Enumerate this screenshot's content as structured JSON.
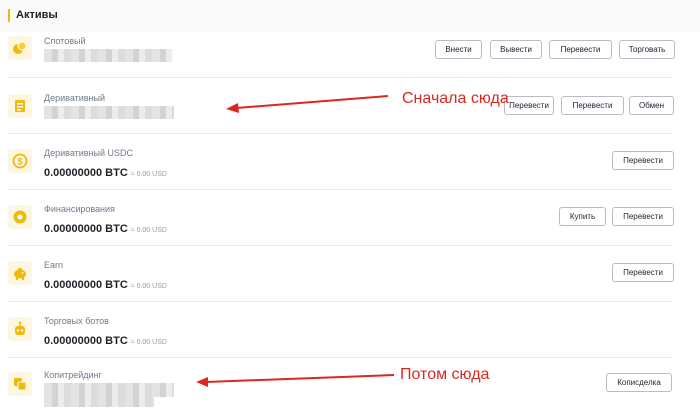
{
  "section": {
    "title": "Активы"
  },
  "accounts": [
    {
      "name": "Спотовый",
      "buttons": [
        "Внести",
        "Вывести",
        "Перевести",
        "Торговать"
      ],
      "icon": "coins-icon"
    },
    {
      "name": "Деривативный",
      "buttons": [
        "Перевести",
        "Перевести",
        "Обмен"
      ],
      "icon": "document-icon"
    },
    {
      "name": "Деривативный USDC",
      "btc": "0.00000000 BTC",
      "usd": "≈ 0.00 USD",
      "buttons": [
        "Перевести"
      ],
      "icon": "dollar-coin-icon"
    },
    {
      "name": "Финансирования",
      "btc": "0.00000000 BTC",
      "usd": "≈ 0.00 USD",
      "buttons": [
        "Купить",
        "Перевести"
      ],
      "icon": "target-icon"
    },
    {
      "name": "Earn",
      "btc": "0.00000000 BTC",
      "usd": "≈ 0.00 USD",
      "buttons": [
        "Перевести"
      ],
      "icon": "piggy-bank-icon"
    },
    {
      "name": "Торговых ботов",
      "btc": "0.00000000 BTC",
      "usd": "≈ 0.00 USD",
      "buttons": [],
      "icon": "robot-icon"
    },
    {
      "name": "Копитрейдинг",
      "buttons": [
        "Кописделка"
      ],
      "icon": "copy-icon"
    }
  ],
  "annotations": {
    "first": "Сначала сюда",
    "second": "Потом сюда"
  },
  "colors": {
    "accent": "#f0b90b",
    "annotation": "#d9281f"
  }
}
